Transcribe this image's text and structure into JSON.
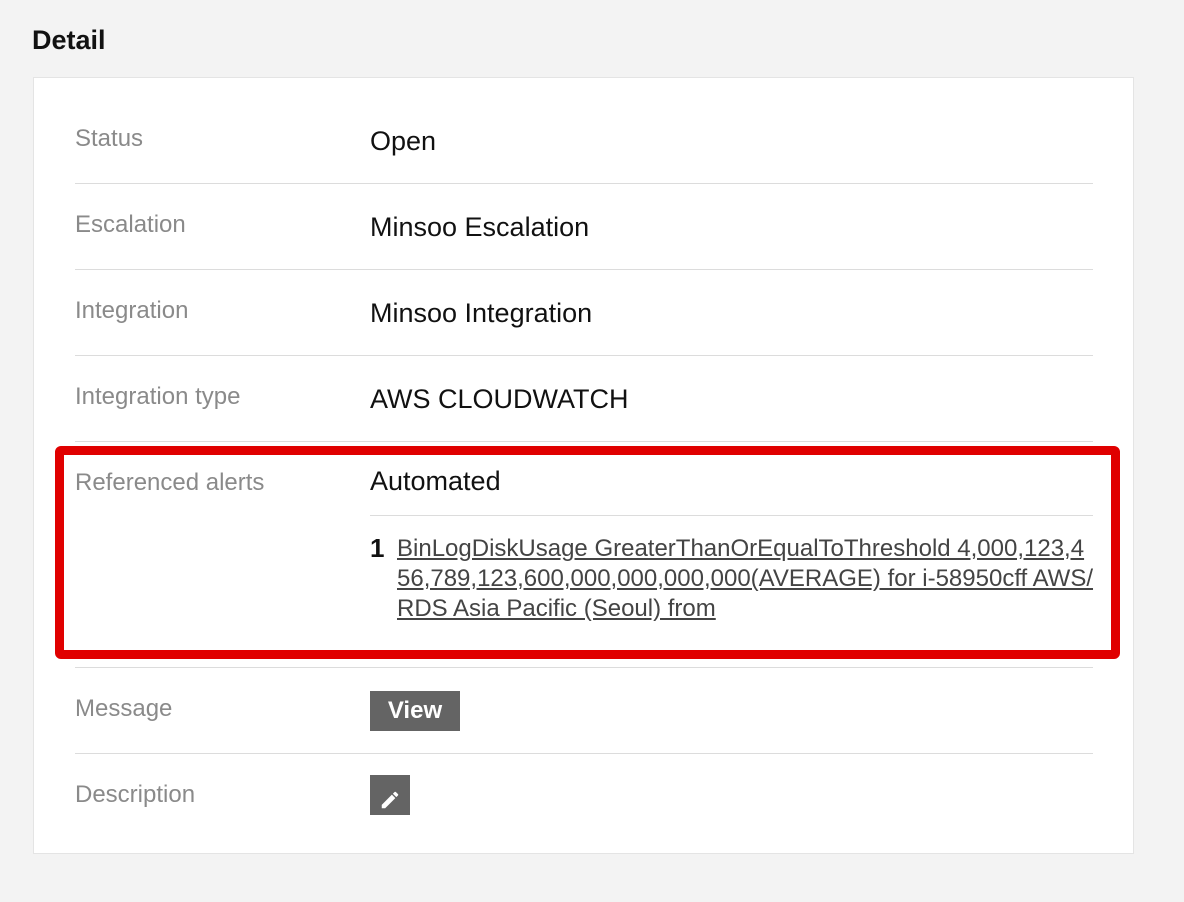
{
  "section": {
    "title": "Detail"
  },
  "fields": {
    "status": {
      "label": "Status",
      "value": "Open"
    },
    "escalation": {
      "label": "Escalation",
      "value": "Minsoo Escalation"
    },
    "integration": {
      "label": "Integration",
      "value": "Minsoo Integration"
    },
    "integration_type": {
      "label": "Integration type",
      "value": "AWS CLOUDWATCH"
    },
    "referenced_alerts": {
      "label": "Referenced alerts",
      "mode": "Automated",
      "items": [
        {
          "number": "1",
          "text": "BinLogDiskUsage GreaterThanOrEqualToThreshold 4,000,123,456,789,123,600,000,000,000,000(AVERAGE) for i-58950cff AWS/RDS Asia Pacific (Seoul) from"
        }
      ]
    },
    "message": {
      "label": "Message",
      "button_label": "View"
    },
    "description": {
      "label": "Description",
      "edit_icon": "pencil-icon"
    }
  },
  "colors": {
    "highlight": "#e00000",
    "button_bg": "#646464",
    "label_text": "#8a8a8a"
  }
}
